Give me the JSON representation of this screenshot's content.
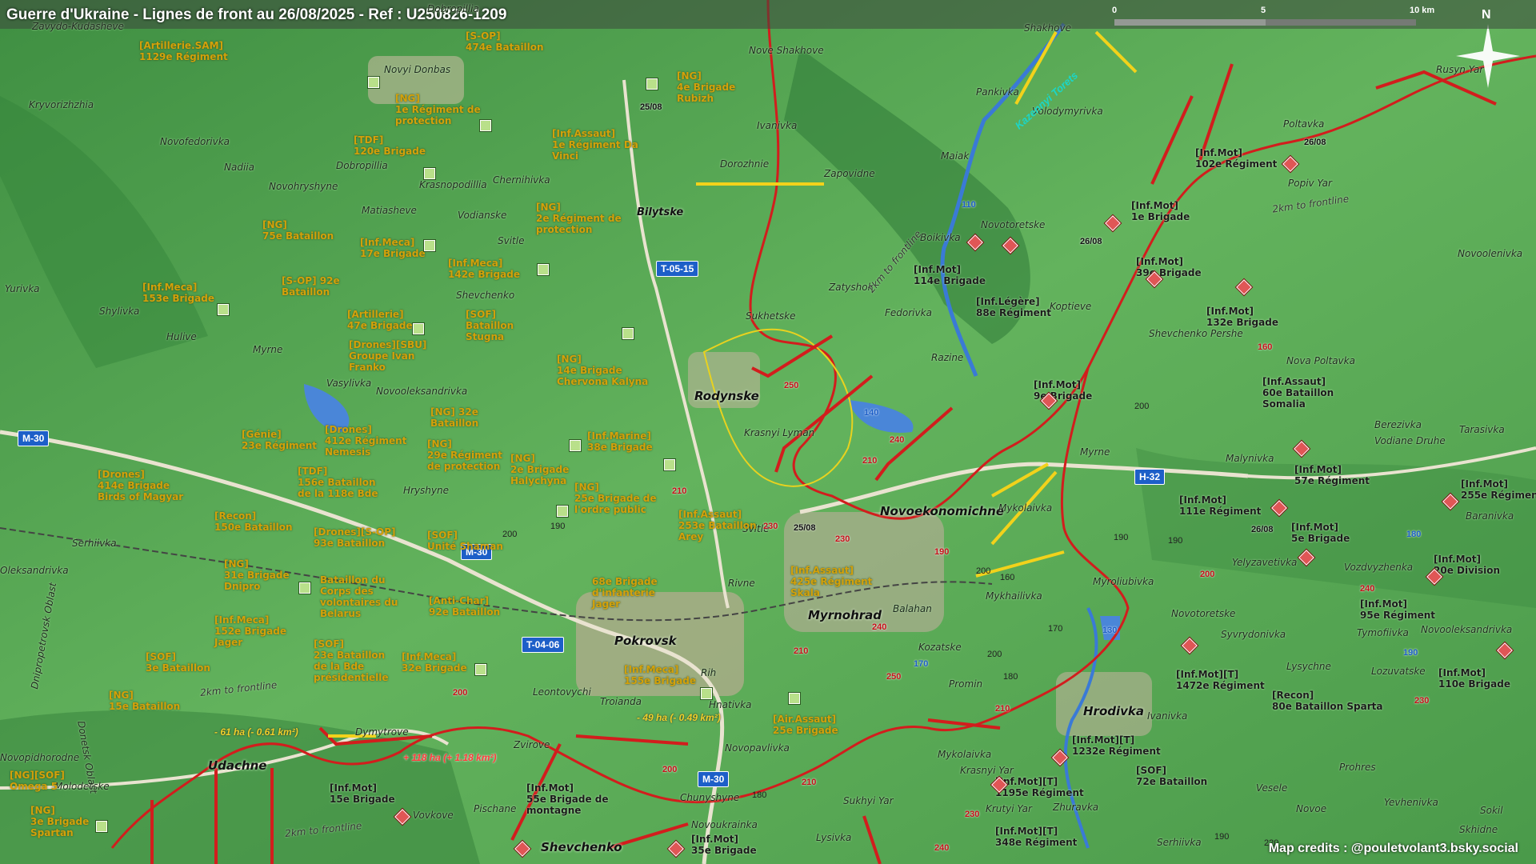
{
  "title": "Guerre d'Ukraine - Lignes de front au 26/08/2025 - Ref : U250826-1209",
  "credits": "Map credits : @pouletvolant3.bsky.social",
  "scale": {
    "labels": [
      "0",
      "5",
      "10 km"
    ],
    "north": "N"
  },
  "colors": {
    "ukraine_units": "#d4a10a",
    "russia_units": "#1b1b1b",
    "front_line": "#d21d1d",
    "ua_arrow": "#f2d21b",
    "road_badge": "#1d5fc8"
  },
  "places": [
    {
      "name": "Zavydo-Kudasheve"
    },
    {
      "name": "Dobropillia"
    },
    {
      "name": "Novyi Donbas"
    },
    {
      "name": "Nove Shakhove"
    },
    {
      "name": "Shakhove"
    },
    {
      "name": "Rusyn Yar"
    },
    {
      "name": "Kryvorizhzhia"
    },
    {
      "name": "Ivanivka"
    },
    {
      "name": "Pankivka"
    },
    {
      "name": "Volodymyrivka"
    },
    {
      "name": "Poltavka"
    },
    {
      "name": "Novofedorivka"
    },
    {
      "name": "Nadiia"
    },
    {
      "name": "Dobropillia"
    },
    {
      "name": "Dorozhnie"
    },
    {
      "name": "Zapovidne"
    },
    {
      "name": "Maiak"
    },
    {
      "name": "Popiv Yar"
    },
    {
      "name": "Novohryshyne"
    },
    {
      "name": "Krasnopodillia"
    },
    {
      "name": "Chernihivka"
    },
    {
      "name": "Bilytske"
    },
    {
      "name": "Matiasheve"
    },
    {
      "name": "Vodianske"
    },
    {
      "name": "Novotoretske"
    },
    {
      "name": "Boikivka"
    },
    {
      "name": "Svitle"
    },
    {
      "name": "Novoolenivka"
    },
    {
      "name": "Yurivka"
    },
    {
      "name": "Zatyshok"
    },
    {
      "name": "Shevchenko"
    },
    {
      "name": "Shylivka"
    },
    {
      "name": "Koptieve"
    },
    {
      "name": "Hulive"
    },
    {
      "name": "Sukhetske"
    },
    {
      "name": "Fedorivka"
    },
    {
      "name": "Shevchenko Pershe"
    },
    {
      "name": "Myrne"
    },
    {
      "name": "Vasylivka"
    },
    {
      "name": "Razine"
    },
    {
      "name": "Nova Poltavka"
    },
    {
      "name": "Novooleksandrivka"
    },
    {
      "name": "Rodynske"
    },
    {
      "name": "Berezivka"
    },
    {
      "name": "Tarasivka"
    },
    {
      "name": "Krasnyi Lyman"
    },
    {
      "name": "Vodiane Druhe"
    },
    {
      "name": "Myrne"
    },
    {
      "name": "Malynivka"
    },
    {
      "name": "Hryshyne"
    },
    {
      "name": "Mykolaivka"
    },
    {
      "name": "Baranivka"
    },
    {
      "name": "Serhiivka"
    },
    {
      "name": "Svitle"
    },
    {
      "name": "Yelyzavetivka"
    },
    {
      "name": "Vozdvyzhenka"
    },
    {
      "name": "Rivne"
    },
    {
      "name": "Mykhailivka"
    },
    {
      "name": "Myroliubivka"
    },
    {
      "name": "Novotoretske"
    },
    {
      "name": "Tymofiivka"
    },
    {
      "name": "Balahan"
    },
    {
      "name": "Syvrydonivka"
    },
    {
      "name": "Novooleksandrivka"
    },
    {
      "name": "Kozatske"
    },
    {
      "name": "Lysychne"
    },
    {
      "name": "Lozuvatske"
    },
    {
      "name": "Rih"
    },
    {
      "name": "Leontovychi"
    },
    {
      "name": "Troianda"
    },
    {
      "name": "Hnativka"
    },
    {
      "name": "Promin"
    },
    {
      "name": "Ivanivka"
    },
    {
      "name": "Novopavlivka"
    },
    {
      "name": "Zvirove"
    },
    {
      "name": "Udachne"
    },
    {
      "name": "Dymytrove"
    },
    {
      "name": "Mykolaivka"
    },
    {
      "name": "Krasnyi Yar"
    },
    {
      "name": "Prohres"
    },
    {
      "name": "Molodetske"
    },
    {
      "name": "Vesele"
    },
    {
      "name": "Chunyshyne"
    },
    {
      "name": "Novoukrainka"
    },
    {
      "name": "Pischane"
    },
    {
      "name": "Vovkove"
    },
    {
      "name": "Krutyi Yar"
    },
    {
      "name": "Zhuravka"
    },
    {
      "name": "Novo Yar"
    },
    {
      "name": "Sukhyi Yar"
    },
    {
      "name": "Lysivka"
    },
    {
      "name": "Serhiivka"
    },
    {
      "name": "Novoe"
    },
    {
      "name": "Yevhenivka"
    },
    {
      "name": "Sokil"
    },
    {
      "name": "Skhidne"
    },
    {
      "name": "Oleksandrivka"
    },
    {
      "name": "Novopidhorodne"
    },
    {
      "name": "Dnipropetrovsk Oblast"
    },
    {
      "name": "Donetsk Oblast"
    }
  ],
  "towns": [
    {
      "name": "Rodynske"
    },
    {
      "name": "Novoekonomichne"
    },
    {
      "name": "Myrnohrad"
    },
    {
      "name": "Pokrovsk"
    },
    {
      "name": "Udachne"
    },
    {
      "name": "Hrodivka"
    },
    {
      "name": "Shevchenko"
    }
  ],
  "roads": [
    "T-05-15",
    "M-30",
    "M-30",
    "H-32",
    "T-04-06",
    "M-30"
  ],
  "river": "Kazennyi Torets",
  "frontline_notes": [
    "2km to frontline",
    "2km to frontline",
    "2km to frontline",
    "2km to frontline"
  ],
  "ua_units": [
    "[Artillerie.SAM]\n1129e Régiment",
    "[S-OP]\n474e Bataillon",
    "[NG]\n4e Brigade\nRubizh",
    "[NG]\n1e Régiment de\nprotection",
    "[TDF]\n120e Brigade",
    "[Inf.Assaut]\n1e Régiment Da\nVinci",
    "[NG]\n2e Régiment de\nprotection",
    "[NG]\n75e Bataillon",
    "[Inf.Meca]\n17e Brigade",
    "[Inf.Meca]\n142e Brigade",
    "[Inf.Meca]\n153e Brigade",
    "[S-OP] 92e\nBataillon",
    "[Artillerie]\n47e Brigade",
    "[SOF]\nBataillon\nStugna",
    "[Drones][SBU]\nGroupe Ivan\nFranko",
    "[NG]\n14e Brigade\nChervona Kalyna",
    "[NG] 32e\nBataillon",
    "[Génie]\n23e Régiment",
    "[Drones]\n412e Régiment\nNemesis",
    "[NG]\n29e Régiment\nde protection",
    "[Inf.Marine]\n38e Brigade",
    "[Drones]\n414e Brigade\nBirds of Magyar",
    "[TDF]\n156e Bataillon\nde la 118e Bde",
    "[NG]\n2e Brigade\nHalychyna",
    "[NG]\n25e Brigade de\nl'ordre public",
    "[Recon]\n150e Bataillon",
    "[Drones][S-OP]\n93e Bataillon",
    "[SOF]\nUnité Shaman",
    "[Inf.Assaut]\n253e Bataillon\nArey",
    "[NG]\n31e Brigade\nDnipro",
    "Bataillon du\nCorps des\nvolontaires du\nBelarus",
    "68e Brigade\nd'infanterie\nJager",
    "[Inf.Assaut]\n425e Régiment\nSkala",
    "[Anti-Char]\n92e Bataillon",
    "[Inf.Meca]\n152e Brigade\nJager",
    "[SOF]\n3e Bataillon",
    "[SOF]\n23e Bataillon\nde la Bde\nprésidentielle",
    "[Inf.Meca]\n32e Brigade",
    "[Inf.Meca]\n155e Brigade",
    "[NG]\n15e Bataillon",
    "[Air.Assaut]\n25e Brigade",
    "[NG][SOF]\nOmega 5",
    "[NG]\n3e Brigade\nSpartan"
  ],
  "ru_units": [
    "[Inf.Mot]\n102e Régiment",
    "[Inf.Mot]\n1e Brigade",
    "[Inf.Mot]\n114e Brigade",
    "[Inf.Mot]\n39e Brigade",
    "[Inf.Légère]\n88e Régiment",
    "[Inf.Mot]\n132e Brigade",
    "[Inf.Mot]\n9e Brigade",
    "[Inf.Assaut]\n60e Bataillon\nSomalia",
    "[Inf.Mot]\n57e Régiment",
    "[Inf.Mot]\n255e Régiment",
    "[Inf.Mot]\n111e Régiment",
    "[Inf.Mot]\n5e Brigade",
    "[Inf.Mot]\n20e Division",
    "[Inf.Mot]\n95e Régiment",
    "[Inf.Mot]\n110e Brigade",
    "[Inf.Mot][T]\n1472e Régiment",
    "[Recon]\n80e Bataillon Sparta",
    "[Inf.Mot][T]\n1232e Régiment",
    "[SOF]\n72e Bataillon",
    "[Inf.Mot][T]\n1195e Régiment",
    "[Inf.Mot]\n15e Brigade",
    "[Inf.Mot]\n55e Brigade de\nmontagne",
    "[Inf.Mot][T]\n348e Régiment",
    "[Inf.Mot]\n35e Brigade"
  ],
  "dates": [
    "25/08",
    "26/08",
    "26/08",
    "25/08",
    "26/08"
  ],
  "area_changes": {
    "loss_1": "- 61 ha (- 0.61 km²)",
    "loss_2": "- 49 ha (- 0.49 km²)",
    "gain_1": "+ 118 ha (+ 1.18 km²)"
  },
  "elevations_black": [
    "200",
    "190",
    "180",
    "150",
    "200",
    "170",
    "160",
    "190",
    "170",
    "200",
    "180",
    "190",
    "170",
    "200",
    "220",
    "210",
    "190",
    "210",
    "180"
  ],
  "elevations_red": [
    "250",
    "210",
    "240",
    "230",
    "230",
    "210",
    "190",
    "240",
    "250",
    "210",
    "210",
    "200",
    "200",
    "210",
    "230",
    "240",
    "210",
    "200",
    "240",
    "230",
    "160",
    "120",
    "110",
    "140",
    "130",
    "170",
    "180",
    "190"
  ]
}
